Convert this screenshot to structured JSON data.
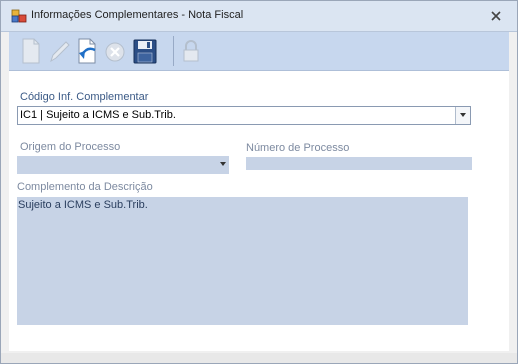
{
  "window": {
    "title": "Informações Complementares - Nota Fiscal",
    "icon": "app-windows-icon",
    "close_icon": "close-icon"
  },
  "toolbar": {
    "buttons": [
      {
        "name": "new-icon",
        "enabled": false
      },
      {
        "name": "edit-icon",
        "enabled": false
      },
      {
        "name": "undo-icon",
        "enabled": true
      },
      {
        "name": "delete-icon",
        "enabled": false
      },
      {
        "name": "save-icon",
        "enabled": true
      },
      {
        "name": "lock-icon",
        "enabled": false
      }
    ]
  },
  "form": {
    "codigo_label": "Código Inf. Complementar",
    "codigo_value": "IC1 | Sujeito a ICMS e Sub.Trib.",
    "origem_label": "Origem do Processo",
    "origem_value": "",
    "numero_label": "Número de Processo",
    "numero_value": "",
    "complemento_label": "Complemento da Descrição",
    "complemento_value": "Sujeito a ICMS e Sub.Trib."
  },
  "colors": {
    "accent": "#c7d7ee",
    "disabled_field": "#c7d3e6",
    "label_text": "#3b5a86"
  }
}
